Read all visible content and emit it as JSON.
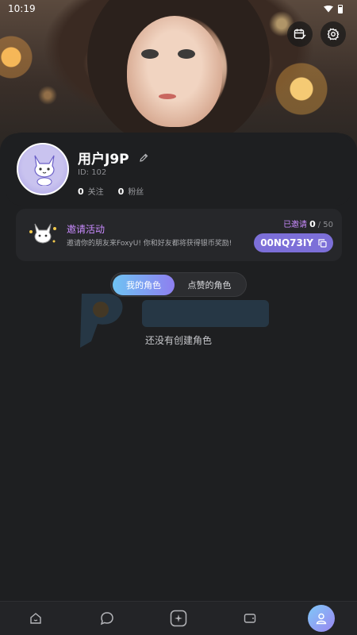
{
  "status_bar": {
    "time": "10:19"
  },
  "icons": {
    "calendar": "calendar-edit-icon",
    "settings": "gear-icon",
    "edit": "pencil-icon",
    "copy": "copy-icon",
    "nav": [
      "home-icon",
      "chat-icon",
      "create-icon",
      "wallet-icon",
      "profile-icon"
    ]
  },
  "profile": {
    "username": "用户J9P",
    "id_label": "ID: 102",
    "following_count": "0",
    "following_label": "关注",
    "followers_count": "0",
    "followers_label": "粉丝"
  },
  "invite": {
    "title": "邀请活动",
    "description": "邀请你的朋友来FoxyU! 你和好友都将获得银币奖励!",
    "invited_label": "已邀请",
    "invited_count": "0",
    "invited_total": "/ 50",
    "code": "00NQ73IY"
  },
  "tabs": [
    {
      "label": "我的角色",
      "active": true
    },
    {
      "label": "点赞的角色",
      "active": false
    }
  ],
  "empty_state": "还没有创建角色",
  "colors": {
    "accent_purple": "#7c6fd8",
    "invite_pink": "#c98bff",
    "gradient_start": "#6fc3f3",
    "gradient_end": "#8e7ff0",
    "background": "#1e1f21"
  }
}
